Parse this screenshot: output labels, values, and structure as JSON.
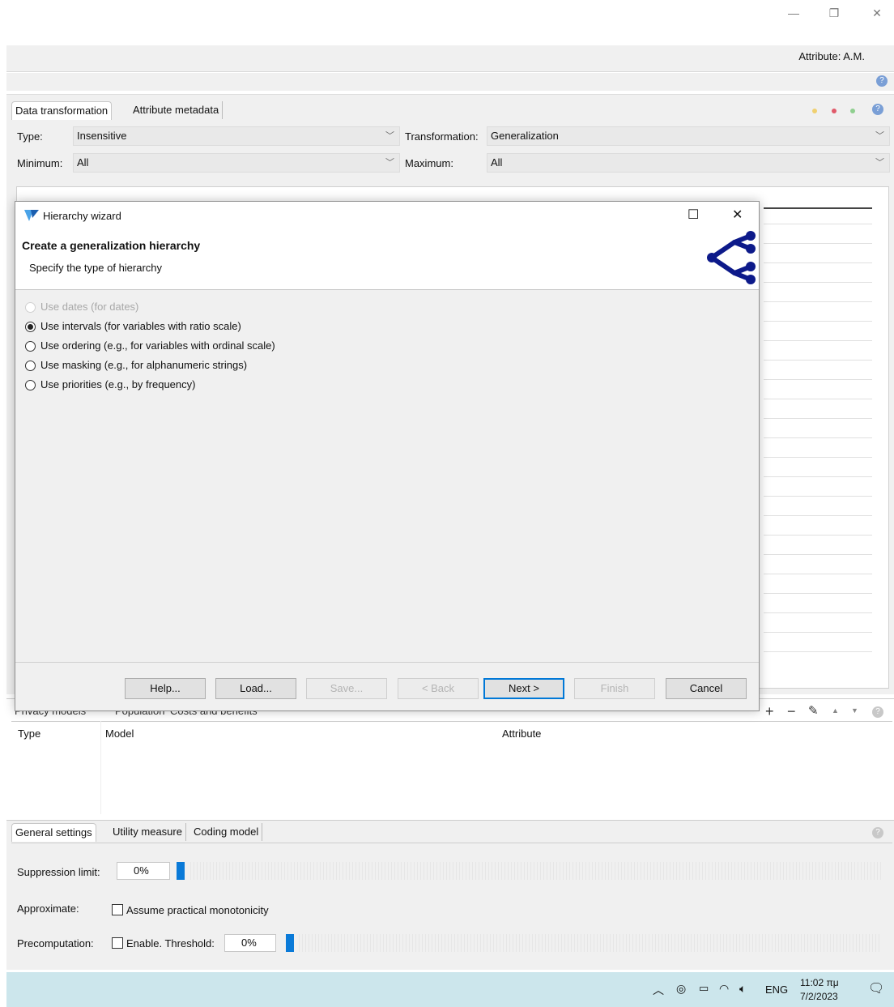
{
  "window": {
    "controls": {
      "minimize": "—",
      "restore": "❐",
      "close": "✕"
    }
  },
  "header": {
    "attribute_label": "Attribute: A.M."
  },
  "transform_panel": {
    "tabs": [
      "Data transformation",
      "Attribute metadata"
    ],
    "type_label": "Type:",
    "type_value": "Insensitive",
    "transformation_label": "Transformation:",
    "transformation_value": "Generalization",
    "minimum_label": "Minimum:",
    "minimum_value": "All",
    "maximum_label": "Maximum:",
    "maximum_value": "All"
  },
  "wizard": {
    "title": "Hierarchy wizard",
    "heading": "Create a generalization hierarchy",
    "subheading": "Specify the type of hierarchy",
    "options": [
      {
        "label": "Use dates (for dates)",
        "selected": false,
        "enabled": false
      },
      {
        "label": "Use intervals (for variables with ratio scale)",
        "selected": true,
        "enabled": true
      },
      {
        "label": "Use ordering (e.g., for variables with ordinal scale)",
        "selected": false,
        "enabled": true
      },
      {
        "label": "Use masking (e.g., for alphanumeric strings)",
        "selected": false,
        "enabled": true
      },
      {
        "label": "Use priorities (e.g., by frequency)",
        "selected": false,
        "enabled": true
      }
    ],
    "buttons": {
      "help": "Help...",
      "load": "Load...",
      "save": "Save...",
      "back": "< Back",
      "next": "Next >",
      "finish": "Finish",
      "cancel": "Cancel"
    },
    "controls": {
      "maximize": "☐",
      "close": "✕"
    }
  },
  "privacy_panel": {
    "tabs": [
      "Privacy models",
      "Population",
      "Costs and benefits"
    ],
    "columns": [
      "Type",
      "Model",
      "Attribute"
    ],
    "toolbar": [
      "+",
      "−"
    ]
  },
  "settings_panel": {
    "tabs": [
      "General settings",
      "Utility measure",
      "Coding model"
    ],
    "suppression_label": "Suppression limit:",
    "suppression_value": "0%",
    "suppression_level": 0,
    "approximate_label": "Approximate:",
    "monotonicity_label": "Assume practical monotonicity",
    "precomputation_label": "Precomputation:",
    "enable_label": "Enable. Threshold:",
    "threshold_value": "0%",
    "threshold_level": 0
  },
  "taskbar": {
    "language": "ENG",
    "time": "11:02 πμ",
    "date": "7/2/2023"
  },
  "colors": {
    "accent": "#0078d7",
    "taskbar": "#cce6ec",
    "slider": "#0a7ad8"
  }
}
